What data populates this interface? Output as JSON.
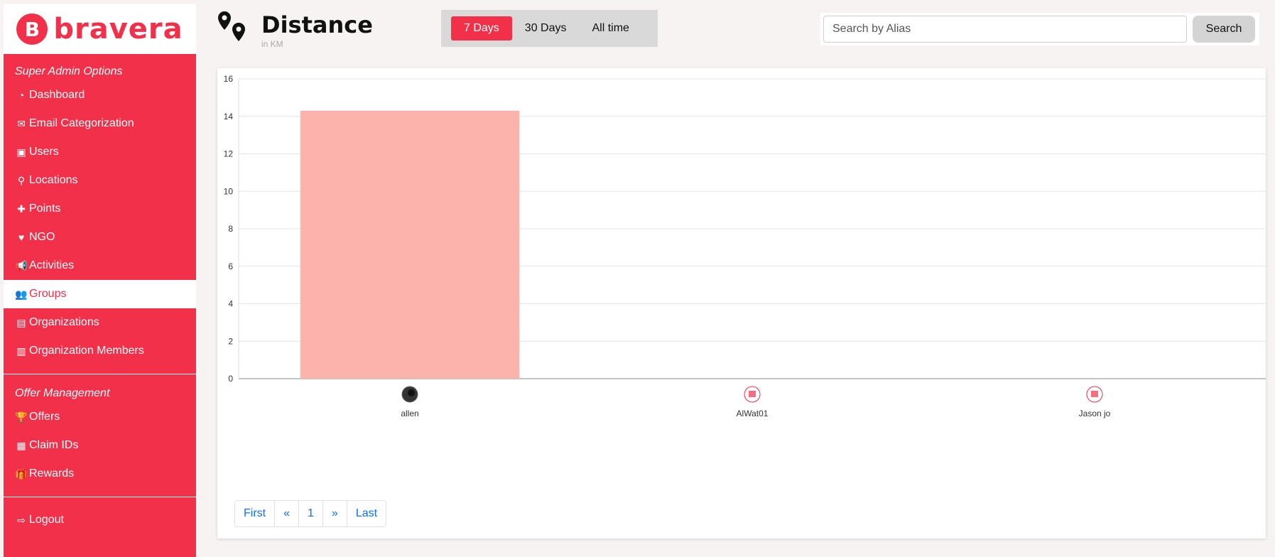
{
  "brand": {
    "name": "bravera",
    "mark": "B",
    "color": "#f2304a"
  },
  "sidebar": {
    "section1_title": "Super Admin Options",
    "items1": [
      {
        "label": "Dashboard",
        "icon": "dashboard-icon",
        "glyph": "◔"
      },
      {
        "label": "Email Categorization",
        "icon": "envelope-icon",
        "glyph": "✉"
      },
      {
        "label": "Users",
        "icon": "user-card-icon",
        "glyph": "▣"
      },
      {
        "label": "Locations",
        "icon": "map-pin-icon",
        "glyph": "⚲"
      },
      {
        "label": "Points",
        "icon": "plus-icon",
        "glyph": "✚"
      },
      {
        "label": "NGO",
        "icon": "heart-icon",
        "glyph": "♥"
      },
      {
        "label": "Activities",
        "icon": "megaphone-icon",
        "glyph": "📢"
      },
      {
        "label": "Groups",
        "icon": "users-group-icon",
        "glyph": "👥",
        "active": true
      },
      {
        "label": "Organizations",
        "icon": "building-icon",
        "glyph": "▤"
      },
      {
        "label": "Organization Members",
        "icon": "id-badge-icon",
        "glyph": "▥"
      }
    ],
    "section2_title": "Offer Management",
    "items2": [
      {
        "label": "Offers",
        "icon": "trophy-icon",
        "glyph": "🏆"
      },
      {
        "label": "Claim IDs",
        "icon": "qrcode-icon",
        "glyph": "▦"
      },
      {
        "label": "Rewards",
        "icon": "gift-icon",
        "glyph": "🎁"
      }
    ],
    "logout_label": "Logout"
  },
  "header": {
    "title": "Distance",
    "subtitle": "in KM",
    "ranges": [
      {
        "label": "7 Days",
        "active": true
      },
      {
        "label": "30 Days",
        "active": false
      },
      {
        "label": "All time",
        "active": false
      }
    ]
  },
  "search": {
    "placeholder": "Search by Alias",
    "button_label": "Search"
  },
  "chart_data": {
    "type": "bar",
    "categories": [
      "allen",
      "AlWat01",
      "Jason jo"
    ],
    "values": [
      14.3,
      0,
      0
    ],
    "ylim": [
      0,
      16
    ],
    "yticks": [
      0,
      2,
      4,
      6,
      8,
      10,
      12,
      14,
      16
    ],
    "bar_color": "#fbb3ab",
    "grid": true
  },
  "pagination": [
    "First",
    "«",
    "1",
    "»",
    "Last"
  ]
}
